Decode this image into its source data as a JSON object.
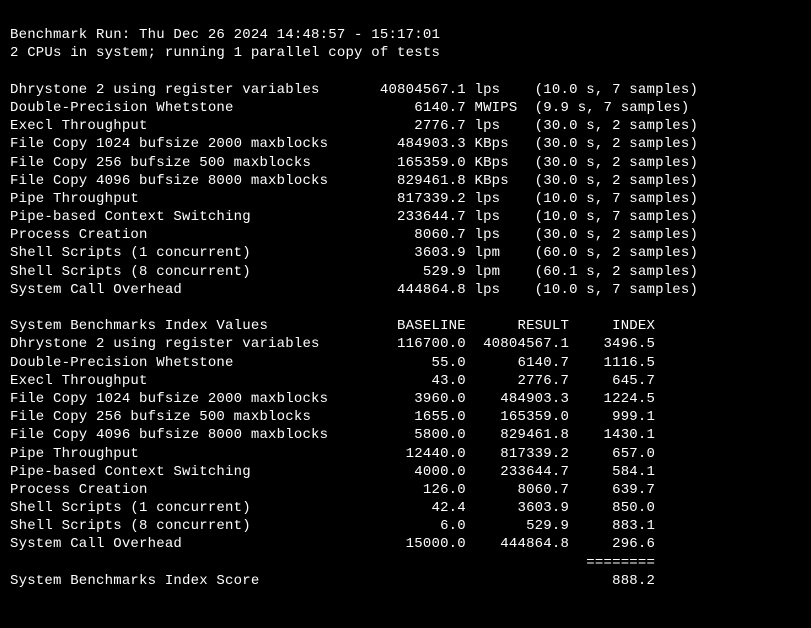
{
  "header": {
    "line1": "Benchmark Run: Thu Dec 26 2024 14:48:57 - 15:17:01",
    "line2": "2 CPUs in system; running 1 parallel copy of tests"
  },
  "results": [
    {
      "name": "Dhrystone 2 using register variables",
      "value": "40804567.1",
      "unit": "lps",
      "timing": "(10.0 s, 7 samples)"
    },
    {
      "name": "Double-Precision Whetstone",
      "value": "6140.7",
      "unit": "MWIPS",
      "timing": "(9.9 s, 7 samples)"
    },
    {
      "name": "Execl Throughput",
      "value": "2776.7",
      "unit": "lps",
      "timing": "(30.0 s, 2 samples)"
    },
    {
      "name": "File Copy 1024 bufsize 2000 maxblocks",
      "value": "484903.3",
      "unit": "KBps",
      "timing": "(30.0 s, 2 samples)"
    },
    {
      "name": "File Copy 256 bufsize 500 maxblocks",
      "value": "165359.0",
      "unit": "KBps",
      "timing": "(30.0 s, 2 samples)"
    },
    {
      "name": "File Copy 4096 bufsize 8000 maxblocks",
      "value": "829461.8",
      "unit": "KBps",
      "timing": "(30.0 s, 2 samples)"
    },
    {
      "name": "Pipe Throughput",
      "value": "817339.2",
      "unit": "lps",
      "timing": "(10.0 s, 7 samples)"
    },
    {
      "name": "Pipe-based Context Switching",
      "value": "233644.7",
      "unit": "lps",
      "timing": "(10.0 s, 7 samples)"
    },
    {
      "name": "Process Creation",
      "value": "8060.7",
      "unit": "lps",
      "timing": "(30.0 s, 2 samples)"
    },
    {
      "name": "Shell Scripts (1 concurrent)",
      "value": "3603.9",
      "unit": "lpm",
      "timing": "(60.0 s, 2 samples)"
    },
    {
      "name": "Shell Scripts (8 concurrent)",
      "value": "529.9",
      "unit": "lpm",
      "timing": "(60.1 s, 2 samples)"
    },
    {
      "name": "System Call Overhead",
      "value": "444864.8",
      "unit": "lps",
      "timing": "(10.0 s, 7 samples)"
    }
  ],
  "index_header": {
    "title": "System Benchmarks Index Values",
    "col_baseline": "BASELINE",
    "col_result": "RESULT",
    "col_index": "INDEX"
  },
  "index": [
    {
      "name": "Dhrystone 2 using register variables",
      "baseline": "116700.0",
      "result": "40804567.1",
      "index": "3496.5"
    },
    {
      "name": "Double-Precision Whetstone",
      "baseline": "55.0",
      "result": "6140.7",
      "index": "1116.5"
    },
    {
      "name": "Execl Throughput",
      "baseline": "43.0",
      "result": "2776.7",
      "index": "645.7"
    },
    {
      "name": "File Copy 1024 bufsize 2000 maxblocks",
      "baseline": "3960.0",
      "result": "484903.3",
      "index": "1224.5"
    },
    {
      "name": "File Copy 256 bufsize 500 maxblocks",
      "baseline": "1655.0",
      "result": "165359.0",
      "index": "999.1"
    },
    {
      "name": "File Copy 4096 bufsize 8000 maxblocks",
      "baseline": "5800.0",
      "result": "829461.8",
      "index": "1430.1"
    },
    {
      "name": "Pipe Throughput",
      "baseline": "12440.0",
      "result": "817339.2",
      "index": "657.0"
    },
    {
      "name": "Pipe-based Context Switching",
      "baseline": "4000.0",
      "result": "233644.7",
      "index": "584.1"
    },
    {
      "name": "Process Creation",
      "baseline": "126.0",
      "result": "8060.7",
      "index": "639.7"
    },
    {
      "name": "Shell Scripts (1 concurrent)",
      "baseline": "42.4",
      "result": "3603.9",
      "index": "850.0"
    },
    {
      "name": "Shell Scripts (8 concurrent)",
      "baseline": "6.0",
      "result": "529.9",
      "index": "883.1"
    },
    {
      "name": "System Call Overhead",
      "baseline": "15000.0",
      "result": "444864.8",
      "index": "296.6"
    }
  ],
  "separator": "                                                                   ========",
  "score": {
    "label": "System Benchmarks Index Score",
    "value": "888.2"
  },
  "layout": {
    "results_name_w": 41,
    "results_value_w": 12,
    "results_unit_w": 5,
    "idx_name_w": 41,
    "idx_baseline_w": 12,
    "idx_result_w": 12,
    "idx_index_w": 10,
    "score_label_w": 65,
    "score_value_w": 10
  }
}
